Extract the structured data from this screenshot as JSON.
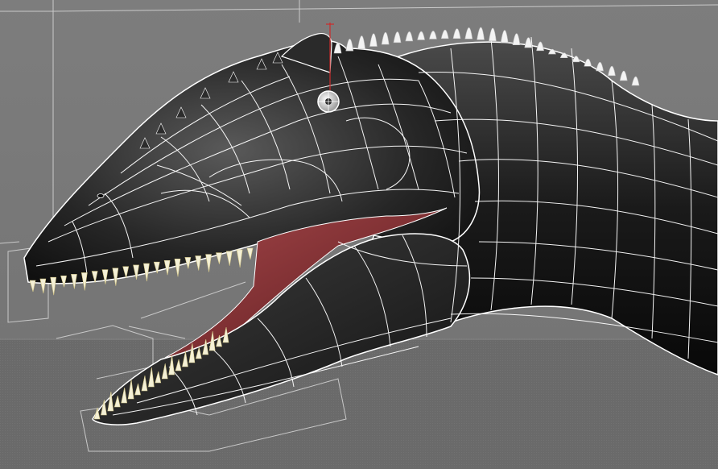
{
  "viewport": {
    "name": "3d-viewport",
    "background_color": "#7a7a7a",
    "ground_color": "#6c6c6c",
    "wireframe_color": "#ffffff",
    "mesh_color": "#1a1a1a",
    "mouth_color": "#8a2f33",
    "teeth_color": "#f4f0d6",
    "pivot_color": "#cc2b2b"
  },
  "model": {
    "subject": "dinosaur-head-wireframe",
    "parts": [
      "head",
      "neck",
      "upper-jaw",
      "lower-jaw",
      "eye",
      "back-spikes",
      "teeth",
      "tongue"
    ]
  }
}
